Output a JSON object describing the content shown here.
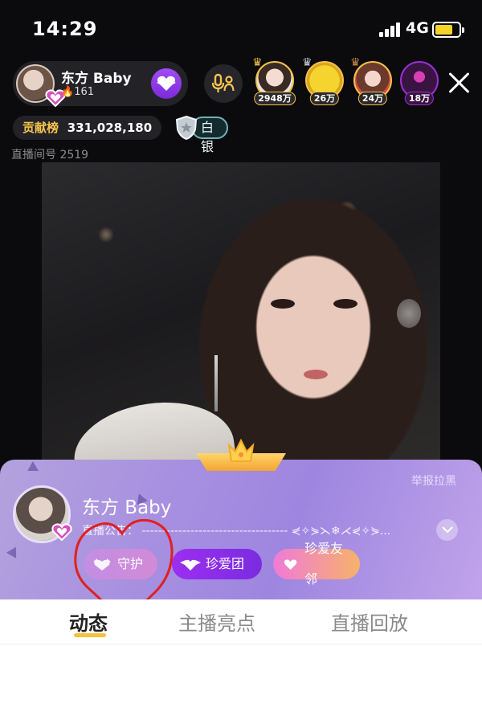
{
  "status_bar": {
    "time": "14:29",
    "network": "4G",
    "battery_level": 0.74
  },
  "host": {
    "name": "东方 Baby",
    "fans": "161"
  },
  "viewers": [
    {
      "count": "2948万",
      "ring_color": "#f4c04a"
    },
    {
      "count": "26万",
      "ring_color": "#f4c04a"
    },
    {
      "count": "24万",
      "ring_color": "#f4c04a"
    },
    {
      "count": "18万",
      "ring_color": "#9a2fd6"
    }
  ],
  "contribution": {
    "label": "贡献榜",
    "value": "331,028,180"
  },
  "rank_badge": {
    "label": "白银"
  },
  "room": {
    "label": "直播间号 2519"
  },
  "card": {
    "report": "举报拉黑",
    "name": "东方 Baby",
    "notice_label": "直播公告：",
    "notice_text": "------------------------------------ ⋞✧⋟⋋❄⋌⋞✧⋟...",
    "tags": [
      {
        "label": "守护",
        "color": "#c28ee4"
      },
      {
        "label": "珍爱团",
        "color": "#8a2ee8"
      },
      {
        "label": "珍爱友邻",
        "color": "#f07ad9"
      }
    ]
  },
  "tabs": [
    {
      "label": "动态",
      "active": true
    },
    {
      "label": "主播亮点",
      "active": false
    },
    {
      "label": "直播回放",
      "active": false
    }
  ],
  "accent": {
    "gold": "#f6c44f",
    "purple": "#8a2ee8",
    "annotation_red": "#e02020"
  }
}
